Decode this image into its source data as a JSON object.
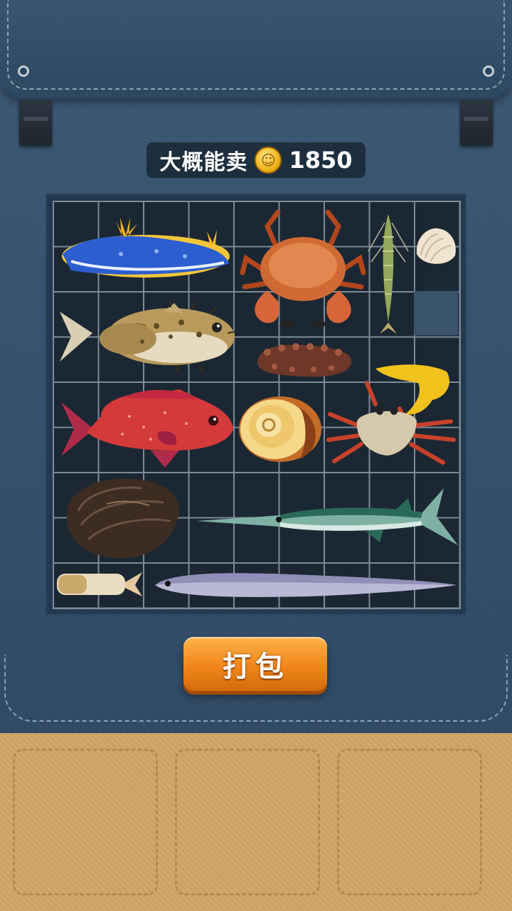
{
  "header": {
    "price_label": "大概能卖",
    "coin_icon": "coin-icon",
    "price_value": "1850"
  },
  "grid": {
    "columns": 9,
    "rows": 9
  },
  "items": [
    {
      "name": "sea-slug-icon"
    },
    {
      "name": "crab-icon"
    },
    {
      "name": "shrimp-icon"
    },
    {
      "name": "clam-icon"
    },
    {
      "name": "pufferfish-icon"
    },
    {
      "name": "sea-cucumber-icon"
    },
    {
      "name": "red-grouper-icon"
    },
    {
      "name": "snail-shell-icon"
    },
    {
      "name": "fiddler-crab-icon"
    },
    {
      "name": "mussel-icon"
    },
    {
      "name": "needlefish-icon"
    },
    {
      "name": "razor-clam-icon"
    },
    {
      "name": "ribbonfish-icon"
    }
  ],
  "button": {
    "pack_label": "打包"
  },
  "tray": {
    "slots": 3
  },
  "colors": {
    "button": "#f0861a",
    "coin": "#f1b51c",
    "tray": "#d3a46a"
  }
}
